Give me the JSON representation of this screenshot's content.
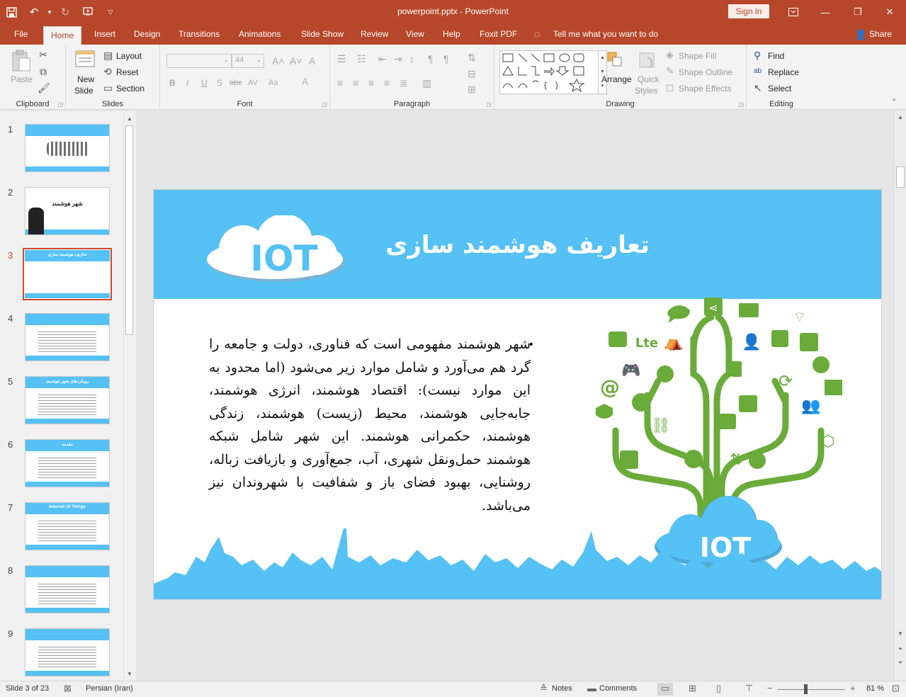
{
  "window": {
    "title": "powerpoint.pptx  -  PowerPoint",
    "sign_in": "Sign in"
  },
  "tabs": [
    "File",
    "Home",
    "Insert",
    "Design",
    "Transitions",
    "Animations",
    "Slide Show",
    "Review",
    "View",
    "Help",
    "Foxit PDF"
  ],
  "tell_me": "Tell me what you want to do",
  "share": "Share",
  "ribbon": {
    "clipboard": {
      "paste": "Paste",
      "label": "Clipboard"
    },
    "slides": {
      "new_slide_1": "New",
      "new_slide_2": "Slide",
      "layout": "Layout",
      "reset": "Reset",
      "section": "Section",
      "label": "Slides"
    },
    "font": {
      "size": "44",
      "label": "Font"
    },
    "paragraph": {
      "label": "Paragraph"
    },
    "drawing": {
      "arrange": "Arrange",
      "quick_styles_1": "Quick",
      "quick_styles_2": "Styles",
      "shape_fill": "Shape Fill",
      "shape_outline": "Shape Outline",
      "shape_effects": "Shape Effects",
      "label": "Drawing"
    },
    "editing": {
      "find": "Find",
      "replace": "Replace",
      "select": "Select",
      "label": "Editing"
    }
  },
  "thumbnails": [
    {
      "num": "1",
      "text": ""
    },
    {
      "num": "2",
      "text": "شهر هوشمند"
    },
    {
      "num": "3",
      "text": "تعاریف هوشمند سازی"
    },
    {
      "num": "4",
      "text": ""
    },
    {
      "num": "5",
      "text": "رویکردهای شهر هوشمند"
    },
    {
      "num": "6",
      "text": "مقدمه"
    },
    {
      "num": "7",
      "text": "Internet Of Things"
    },
    {
      "num": "8",
      "text": ""
    },
    {
      "num": "9",
      "text": ""
    }
  ],
  "slide": {
    "title": "تعاریف هوشمند سازی",
    "logo_text": "IOT",
    "tree_logo_text": "IOT",
    "body": "شهر هوشمند مفهومی است که فناوری، دولت و جامعه را گرد هم می‌آورد و شامل موارد زیر می‌شود (اما محدود به این موارد نیست): اقتصاد هوشمند، انرژی هوشمند، جابه‌جایی هوشمند، محیط (زیست) هوشمند، زندگی هوشمند، حکمرانی هوشمند. این شهر شامل شبکه هوشمند حمل‌ونقل شهری، آب، جمع‌آوری و بازیافت زباله، روشنایی، بهبود فضای باز و شفافیت با شهروندان نیز می‌باشد."
  },
  "status": {
    "slide_counter": "Slide 3 of 23",
    "language": "Persian (Iran)",
    "notes": "Notes",
    "comments": "Comments",
    "zoom": "81 %"
  },
  "colors": {
    "accent": "#b7472a",
    "slide_blue": "#55c1f5",
    "tree_green": "#6aab3a"
  }
}
